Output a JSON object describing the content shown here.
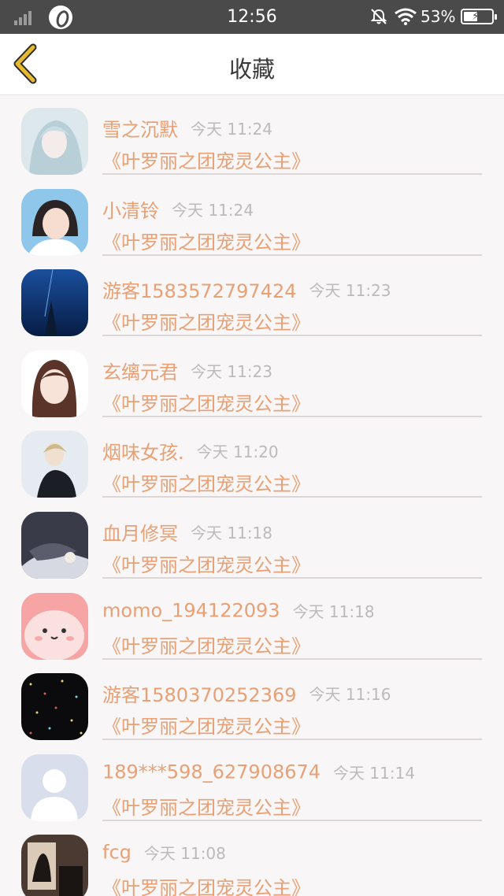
{
  "status_bar": {
    "time": "12:56",
    "battery_percent": "53%"
  },
  "header": {
    "title": "收藏",
    "back_icon": "chevron-left-icon"
  },
  "items": [
    {
      "name": "雪之沉默",
      "time": "今天 11:24",
      "book": "《叶罗丽之团宠灵公主》"
    },
    {
      "name": "小清铃",
      "time": "今天 11:24",
      "book": "《叶罗丽之团宠灵公主》"
    },
    {
      "name": "游客1583572797424",
      "time": "今天 11:23",
      "book": "《叶罗丽之团宠灵公主》"
    },
    {
      "name": "玄缡元君",
      "time": "今天 11:23",
      "book": "《叶罗丽之团宠灵公主》"
    },
    {
      "name": "烟味女孩.",
      "time": "今天 11:20",
      "book": "《叶罗丽之团宠灵公主》"
    },
    {
      "name": "血月修冥",
      "time": "今天 11:18",
      "book": "《叶罗丽之团宠灵公主》"
    },
    {
      "name": "momo_194122093",
      "time": "今天 11:18",
      "book": "《叶罗丽之团宠灵公主》"
    },
    {
      "name": "游客1580370252369",
      "time": "今天 11:16",
      "book": "《叶罗丽之团宠灵公主》"
    },
    {
      "name": "189***598_627908674",
      "time": "今天 11:14",
      "book": "《叶罗丽之团宠灵公主》"
    },
    {
      "name": "fcg",
      "time": "今天 11:08",
      "book": "《叶罗丽之团宠灵公主》"
    }
  ],
  "colors": {
    "accent": "#e8a074",
    "timestamp": "#bbbbbb",
    "back_arrow": "#e6b92e",
    "status_bar_bg": "#4a4a4a"
  }
}
